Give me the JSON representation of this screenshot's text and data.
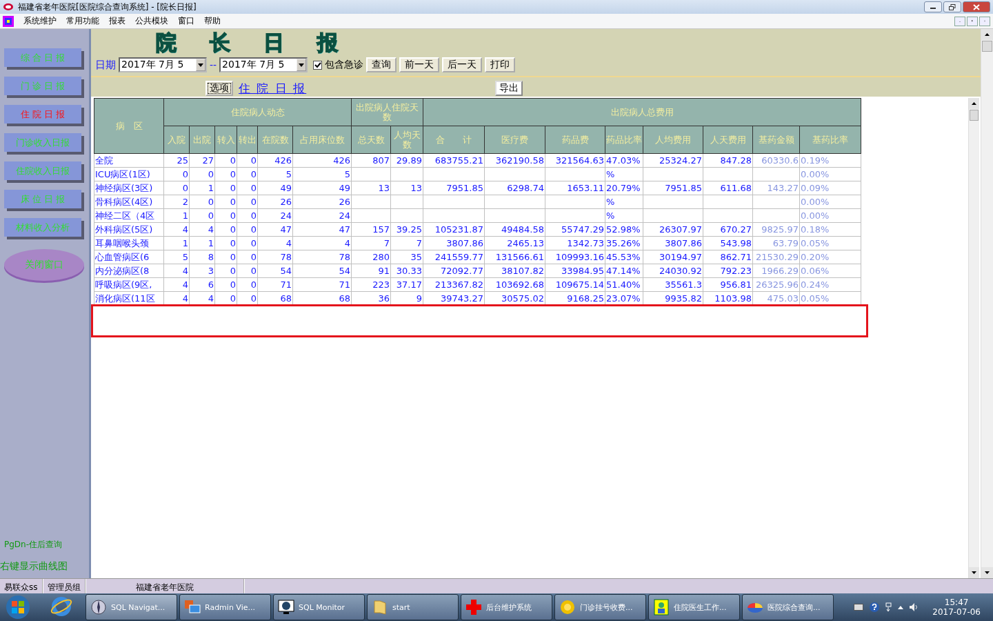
{
  "window": {
    "title": "福建省老年医院[医院综合查询系统] - [院长日报]"
  },
  "menu": {
    "items": [
      "系统维护",
      "常用功能",
      "报表",
      "公共模块",
      "窗口",
      "帮助"
    ]
  },
  "sidebar": {
    "buttons": [
      {
        "label": "综 合 日 报",
        "selected": false
      },
      {
        "label": "门 诊 日 报",
        "selected": false
      },
      {
        "label": "住 院 日 报",
        "selected": true
      },
      {
        "label": "门诊收入日报",
        "selected": false
      },
      {
        "label": "住院收入日报",
        "selected": false
      },
      {
        "label": "床 位 日 报",
        "selected": false
      },
      {
        "label": "材料收入分析",
        "selected": false
      }
    ],
    "close_button": "关闭窗口",
    "hints": [
      "PgDn-住后查询",
      "右键显示曲线图"
    ]
  },
  "toolbar": {
    "heading": "院长日报",
    "date_label": "日期",
    "date_from": "2017年  7月  5",
    "separator": "--",
    "date_to": "2017年  7月  5",
    "checkbox": {
      "label": "包含急诊",
      "checked": true
    },
    "buttons": [
      "查询",
      "前一天",
      "后一天",
      "打印"
    ],
    "options_button": "选项",
    "report_link": "住 院 日 报",
    "export_button": "导出"
  },
  "table": {
    "column_groups": [
      {
        "label": "病　区"
      },
      {
        "label": "住院病人动态",
        "columns": [
          {
            "label": "入院",
            "kind": "number"
          },
          {
            "label": "出院",
            "kind": "number"
          },
          {
            "label": "转入",
            "kind": "number"
          },
          {
            "label": "转出",
            "kind": "number"
          },
          {
            "label": "在院数",
            "kind": "number"
          },
          {
            "label": "占用床位数",
            "kind": "number"
          }
        ]
      },
      {
        "label": "出院病人住院天数",
        "columns": [
          {
            "label": "总天数",
            "kind": "number"
          },
          {
            "label": "人均天数",
            "kind": "number"
          }
        ]
      },
      {
        "label": "出院病人总费用",
        "columns": [
          {
            "label": "合　　计",
            "kind": "number"
          },
          {
            "label": "医疗费",
            "kind": "number"
          },
          {
            "label": "药品费",
            "kind": "number"
          },
          {
            "label": "药品比率",
            "kind": "percent"
          },
          {
            "label": "人均费用",
            "kind": "number"
          },
          {
            "label": "人天费用",
            "kind": "number"
          },
          {
            "label": "基药金额",
            "kind": "dim"
          },
          {
            "label": "基药比率",
            "kind": "dimpercent"
          }
        ]
      }
    ],
    "rows": [
      {
        "ward": "全院",
        "cells": [
          "25",
          "27",
          "0",
          "0",
          "426",
          "426",
          "807",
          "29.89",
          "683755.21",
          "362190.58",
          "321564.63",
          "47.03%",
          "25324.27",
          "847.28",
          "60330.6",
          "0.19%"
        ]
      },
      {
        "ward": "ICU病区(1区)",
        "cells": [
          "0",
          "0",
          "0",
          "0",
          "5",
          "5",
          null,
          null,
          null,
          null,
          null,
          "%",
          null,
          null,
          null,
          "0.00%"
        ]
      },
      {
        "ward": "神经病区(3区)",
        "cells": [
          "0",
          "1",
          "0",
          "0",
          "49",
          "49",
          "13",
          "13",
          "7951.85",
          "6298.74",
          "1653.11",
          "20.79%",
          "7951.85",
          "611.68",
          "143.27",
          "0.09%"
        ]
      },
      {
        "ward": "骨科病区(4区)",
        "cells": [
          "2",
          "0",
          "0",
          "0",
          "26",
          "26",
          null,
          null,
          null,
          null,
          null,
          "%",
          null,
          null,
          null,
          "0.00%"
        ]
      },
      {
        "ward": "神经二区（4区",
        "cells": [
          "1",
          "0",
          "0",
          "0",
          "24",
          "24",
          null,
          null,
          null,
          null,
          null,
          "%",
          null,
          null,
          null,
          "0.00%"
        ]
      },
      {
        "ward": "外科病区(5区)",
        "cells": [
          "4",
          "4",
          "0",
          "0",
          "47",
          "47",
          "157",
          "39.25",
          "105231.87",
          "49484.58",
          "55747.29",
          "52.98%",
          "26307.97",
          "670.27",
          "9825.97",
          "0.18%"
        ]
      },
      {
        "ward": "耳鼻咽喉头颈",
        "cells": [
          "1",
          "1",
          "0",
          "0",
          "4",
          "4",
          "7",
          "7",
          "3807.86",
          "2465.13",
          "1342.73",
          "35.26%",
          "3807.86",
          "543.98",
          "63.79",
          "0.05%"
        ]
      },
      {
        "ward": "心血管病区(6",
        "cells": [
          "5",
          "8",
          "0",
          "0",
          "78",
          "78",
          "280",
          "35",
          "241559.77",
          "131566.61",
          "109993.16",
          "45.53%",
          "30194.97",
          "862.71",
          "21530.29",
          "0.20%"
        ]
      },
      {
        "ward": "内分泌病区(8",
        "cells": [
          "4",
          "3",
          "0",
          "0",
          "54",
          "54",
          "91",
          "30.33",
          "72092.77",
          "38107.82",
          "33984.95",
          "47.14%",
          "24030.92",
          "792.23",
          "1966.29",
          "0.06%"
        ]
      },
      {
        "ward": "呼吸病区(9区,",
        "cells": [
          "4",
          "6",
          "0",
          "0",
          "71",
          "71",
          "223",
          "37.17",
          "213367.82",
          "103692.68",
          "109675.14",
          "51.40%",
          "35561.3",
          "956.81",
          "26325.96",
          "0.24%"
        ]
      },
      {
        "ward": "消化病区(11区",
        "cells": [
          "4",
          "4",
          "0",
          "0",
          "68",
          "68",
          "36",
          "9",
          "39743.27",
          "30575.02",
          "9168.25",
          "23.07%",
          "9935.82",
          "1103.98",
          "475.03",
          "0.05%"
        ]
      }
    ]
  },
  "status_bar": [
    "易联众ss",
    "管理员组",
    "福建省老年医院"
  ],
  "taskbar": {
    "tasks": [
      {
        "label": "SQL Navigat...",
        "selected": true
      },
      {
        "label": "Radmin Vie...",
        "selected": false
      },
      {
        "label": "SQL Monitor",
        "selected": false
      },
      {
        "label": "start",
        "selected": false
      },
      {
        "label": "后台维护系统",
        "selected": false
      },
      {
        "label": "门诊挂号收费...",
        "selected": false
      },
      {
        "label": "住院医生工作...",
        "selected": false
      },
      {
        "label": "医院综合查询...",
        "selected": false
      }
    ],
    "time": "15:47",
    "date": "2017-07-06"
  }
}
